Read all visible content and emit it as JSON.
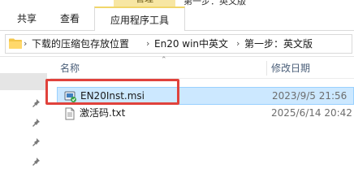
{
  "titlebar": {
    "context_title": "管理",
    "window_title": "第一步：英文版"
  },
  "ribbon": {
    "tabs": [
      {
        "label": "共享"
      },
      {
        "label": "查看"
      },
      {
        "label": "应用程序工具"
      }
    ]
  },
  "address": {
    "crumbs": [
      "下载的压缩包存放位置",
      "En20 win中英文",
      "第一步：英文版"
    ],
    "separator": "›"
  },
  "filelist": {
    "columns": {
      "name": "名称",
      "date": "修改日期"
    },
    "files": [
      {
        "name": "EN20Inst.msi",
        "date": "2023/9/5 21:56",
        "icon": "msi-installer-icon",
        "selected": true
      },
      {
        "name": "激活码.txt",
        "date": "2025/6/14 20:42",
        "icon": "text-file-icon",
        "selected": false
      }
    ]
  },
  "colors": {
    "selection_bg": "#cce8ff",
    "selection_border": "#99d1ff",
    "annotation_red": "#e0423c",
    "context_tab": "#f1d66a"
  }
}
